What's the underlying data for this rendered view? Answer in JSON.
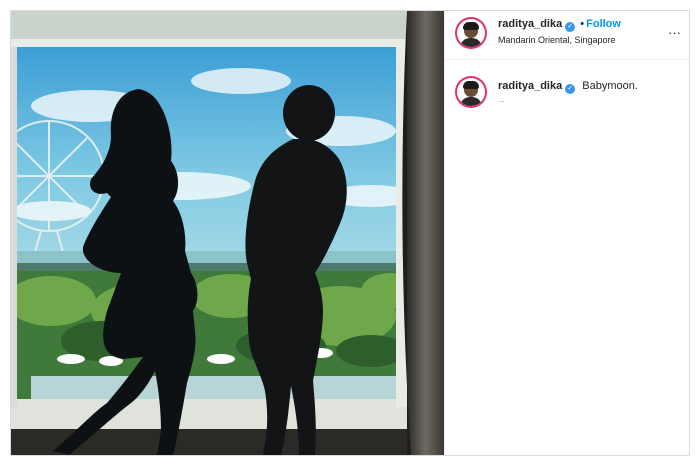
{
  "post": {
    "username": "raditya_dika",
    "verified_icon": "verified-badge-icon",
    "separator": "•",
    "follow_label": "Follow",
    "location": "Mandarin Oriental, Singapore",
    "more_label": "···",
    "caption": "Babymoon.",
    "caption_meta": "..."
  },
  "colors": {
    "follow": "#0095f6",
    "verified": "#3897f0",
    "story_ring": "#e1306c"
  }
}
